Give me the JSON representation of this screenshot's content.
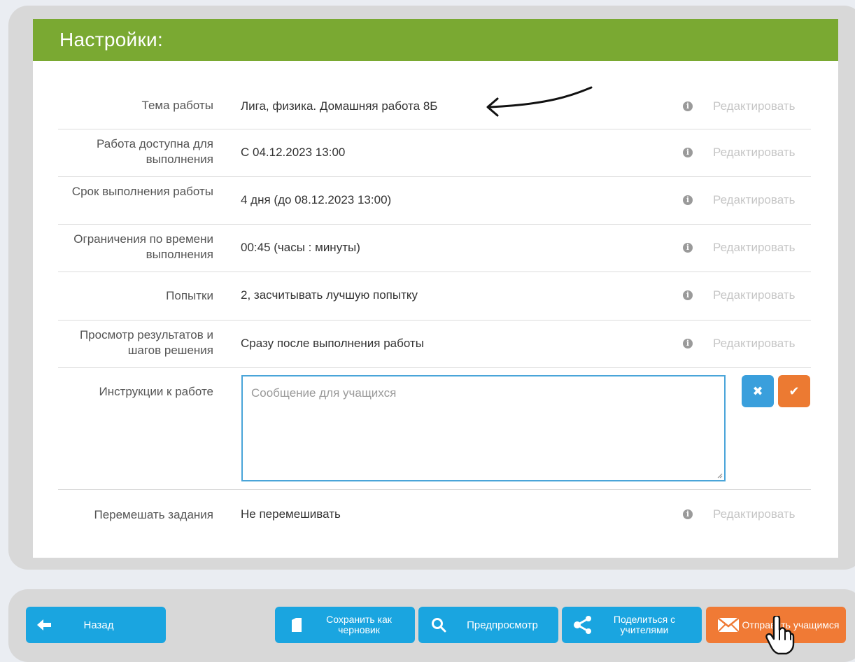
{
  "header": {
    "title": "Настройки:"
  },
  "rows": [
    {
      "label": "Тема работы",
      "value": "Лига, физика. Домашняя работа 8Б",
      "edit": "Редактировать"
    },
    {
      "label": "Работа доступна для выполнения",
      "value": "С 04.12.2023 13:00",
      "edit": "Редактировать"
    },
    {
      "label": "Срок выполнения работы",
      "value": "4 дня (до 08.12.2023 13:00)",
      "edit": "Редактировать"
    },
    {
      "label": "Ограничения по времени выполнения",
      "value": "00:45 (часы : минуты)",
      "edit": "Редактировать"
    },
    {
      "label": "Попытки",
      "value": "2, засчитывать лучшую попытку",
      "edit": "Редактировать"
    },
    {
      "label": "Просмотр результатов и шагов решения",
      "value": "Сразу после выполнения работы",
      "edit": "Редактировать"
    },
    {
      "label": "Инструкции к работе",
      "placeholder": "Сообщение для учащихся"
    },
    {
      "label": "Перемешать задания",
      "value": "Не перемешивать",
      "edit": "Редактировать"
    }
  ],
  "info_icon": "i",
  "toolbar": {
    "back": "Назад",
    "save_draft": "Сохранить как черновик",
    "preview": "Предпросмотр",
    "share": "Поделиться с учителями",
    "send": "Отправить учащимся"
  },
  "colors": {
    "header": "#7aa932",
    "blue": "#1aa5e0",
    "orange": "#f07a35"
  }
}
